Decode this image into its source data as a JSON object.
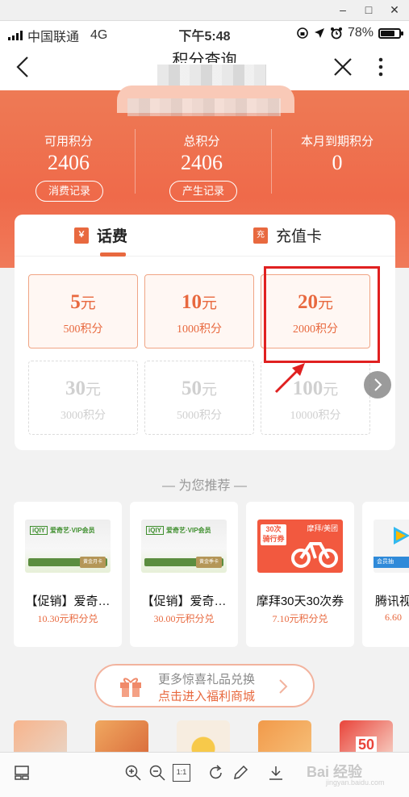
{
  "status_bar": {
    "carrier": "中国联通",
    "network": "4G",
    "time": "下午5:48",
    "battery": "78%",
    "battery_level": 0.78
  },
  "nav": {
    "title": "积分查询"
  },
  "points": {
    "available_label": "可用积分",
    "available_value": "2406",
    "total_label": "总积分",
    "total_value": "2406",
    "expiring_label": "本月到期积分",
    "expiring_value": "0",
    "spend_record_btn": "消费记录",
    "earn_record_btn": "产生记录"
  },
  "tabs": [
    {
      "badge": "￥",
      "label": "话费"
    },
    {
      "badge": "充",
      "label": "充值卡"
    }
  ],
  "tiles": [
    {
      "amount": "5",
      "unit": "元",
      "points": "500积分",
      "enabled": true
    },
    {
      "amount": "10",
      "unit": "元",
      "points": "1000积分",
      "enabled": true
    },
    {
      "amount": "20",
      "unit": "元",
      "points": "2000积分",
      "enabled": true
    },
    {
      "amount": "30",
      "unit": "元",
      "points": "3000积分",
      "enabled": false
    },
    {
      "amount": "50",
      "unit": "元",
      "points": "5000积分",
      "enabled": false
    },
    {
      "amount": "100",
      "unit": "元",
      "points": "10000积分",
      "enabled": false
    }
  ],
  "recommend_title": "— 为您推荐 —",
  "products": [
    {
      "name": "【促销】爱奇…",
      "price": "10.30元积分兑",
      "image": {
        "logo": "爱奇艺·VIP会员",
        "tag": "黄金月卡"
      }
    },
    {
      "name": "【促销】爱奇…",
      "price": "30.00元积分兑",
      "image": {
        "logo": "爱奇艺·VIP会员",
        "tag": "黄金季卡"
      }
    },
    {
      "name": "摩拜30天30次券",
      "price": "7.10元积分兑",
      "image": {
        "badge_line1": "30次",
        "badge_line2": "骑行券",
        "brand": "摩拜/美团"
      }
    },
    {
      "name": "腾讯视",
      "price": "6.60",
      "image": {
        "tag": "会员抽"
      }
    }
  ],
  "banner": {
    "line1": "更多惊喜礼品兑换",
    "line2": "点击进入福利商城"
  },
  "thumbs": [
    {
      "text": ""
    },
    {
      "text": ""
    },
    {
      "text": ""
    },
    {
      "text": ""
    },
    {
      "text": "50"
    }
  ],
  "toolbar": {
    "zoom_label": "1:1"
  },
  "watermark": {
    "text": "Bai 经验",
    "sub": "jingyan.baidu.com"
  },
  "colors": {
    "accent": "#e8693f",
    "hero": "#ef6a4a",
    "highlight": "#e02020"
  }
}
